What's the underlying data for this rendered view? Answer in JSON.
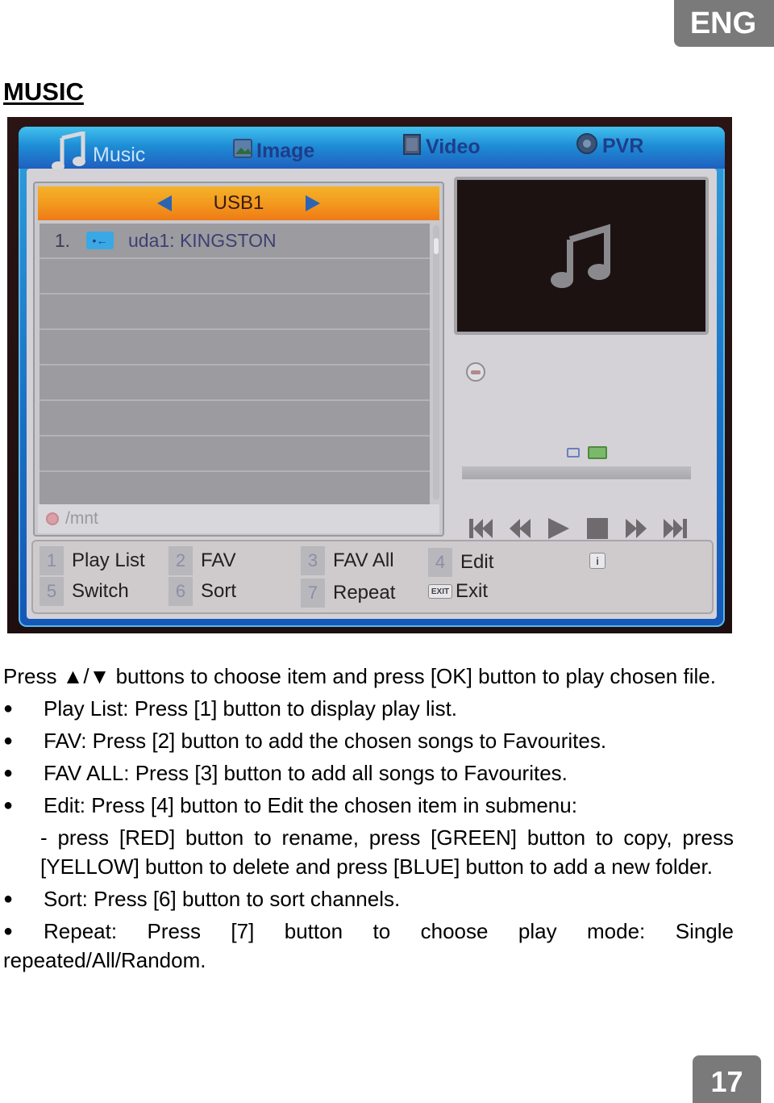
{
  "header": {
    "lang_badge": "ENG",
    "title": "MUSIC"
  },
  "tv": {
    "tabs": [
      {
        "label": "Music",
        "icon": "music-note-icon",
        "active": true
      },
      {
        "label": "Image",
        "icon": "image-icon",
        "active": false
      },
      {
        "label": "Video",
        "icon": "video-icon",
        "active": false
      },
      {
        "label": "PVR",
        "icon": "pvr-icon",
        "active": false
      }
    ],
    "device": {
      "name": "USB1"
    },
    "files": [
      {
        "num": "1.",
        "icon": "usb-icon",
        "name": "uda1: KINGSTON"
      },
      {
        "num": "",
        "name": ""
      },
      {
        "num": "",
        "name": ""
      },
      {
        "num": "",
        "name": ""
      },
      {
        "num": "",
        "name": ""
      },
      {
        "num": "",
        "name": ""
      },
      {
        "num": "",
        "name": ""
      },
      {
        "num": "",
        "name": ""
      }
    ],
    "path": "/mnt",
    "progress": 0,
    "keys": [
      {
        "key": "1",
        "label": "Play List"
      },
      {
        "key": "2",
        "label": "FAV"
      },
      {
        "key": "3",
        "label": "FAV All"
      },
      {
        "key": "4",
        "label": "Edit"
      },
      {
        "key": "5",
        "label": "Switch"
      },
      {
        "key": "6",
        "label": "Sort"
      },
      {
        "key": "7",
        "label": "Repeat"
      },
      {
        "key": "EXIT",
        "label": "Exit"
      }
    ],
    "info_badge": "i",
    "colors": {
      "tab_bar": "#1e8ed6",
      "device_bar": "#f29a1e",
      "frame_bg": "#d4d2d6"
    }
  },
  "body": {
    "intro": "Press ▲/▼ buttons to choose item and press [OK] button to play chosen file.",
    "bullets": [
      "Play List: Press [1] button to display play list.",
      "FAV: Press [2] button to add the chosen songs to Favourites.",
      "FAV ALL: Press [3] button to add all songs to Favourites.",
      "Edit: Press [4] button to Edit the chosen item in submenu:"
    ],
    "edit_sub": "- press [RED] button to rename, press [GREEN] button to copy, press [YELLOW] button to delete and press [BLUE] button to add a new folder.",
    "sort": "Sort: Press [6] button to sort channels.",
    "repeat_line1": "Repeat: Press [7] button to choose play mode: Single",
    "repeat_line2": "repeated/All/Random.",
    "bullet_glyph": "●"
  },
  "footer": {
    "page_number": "17"
  }
}
